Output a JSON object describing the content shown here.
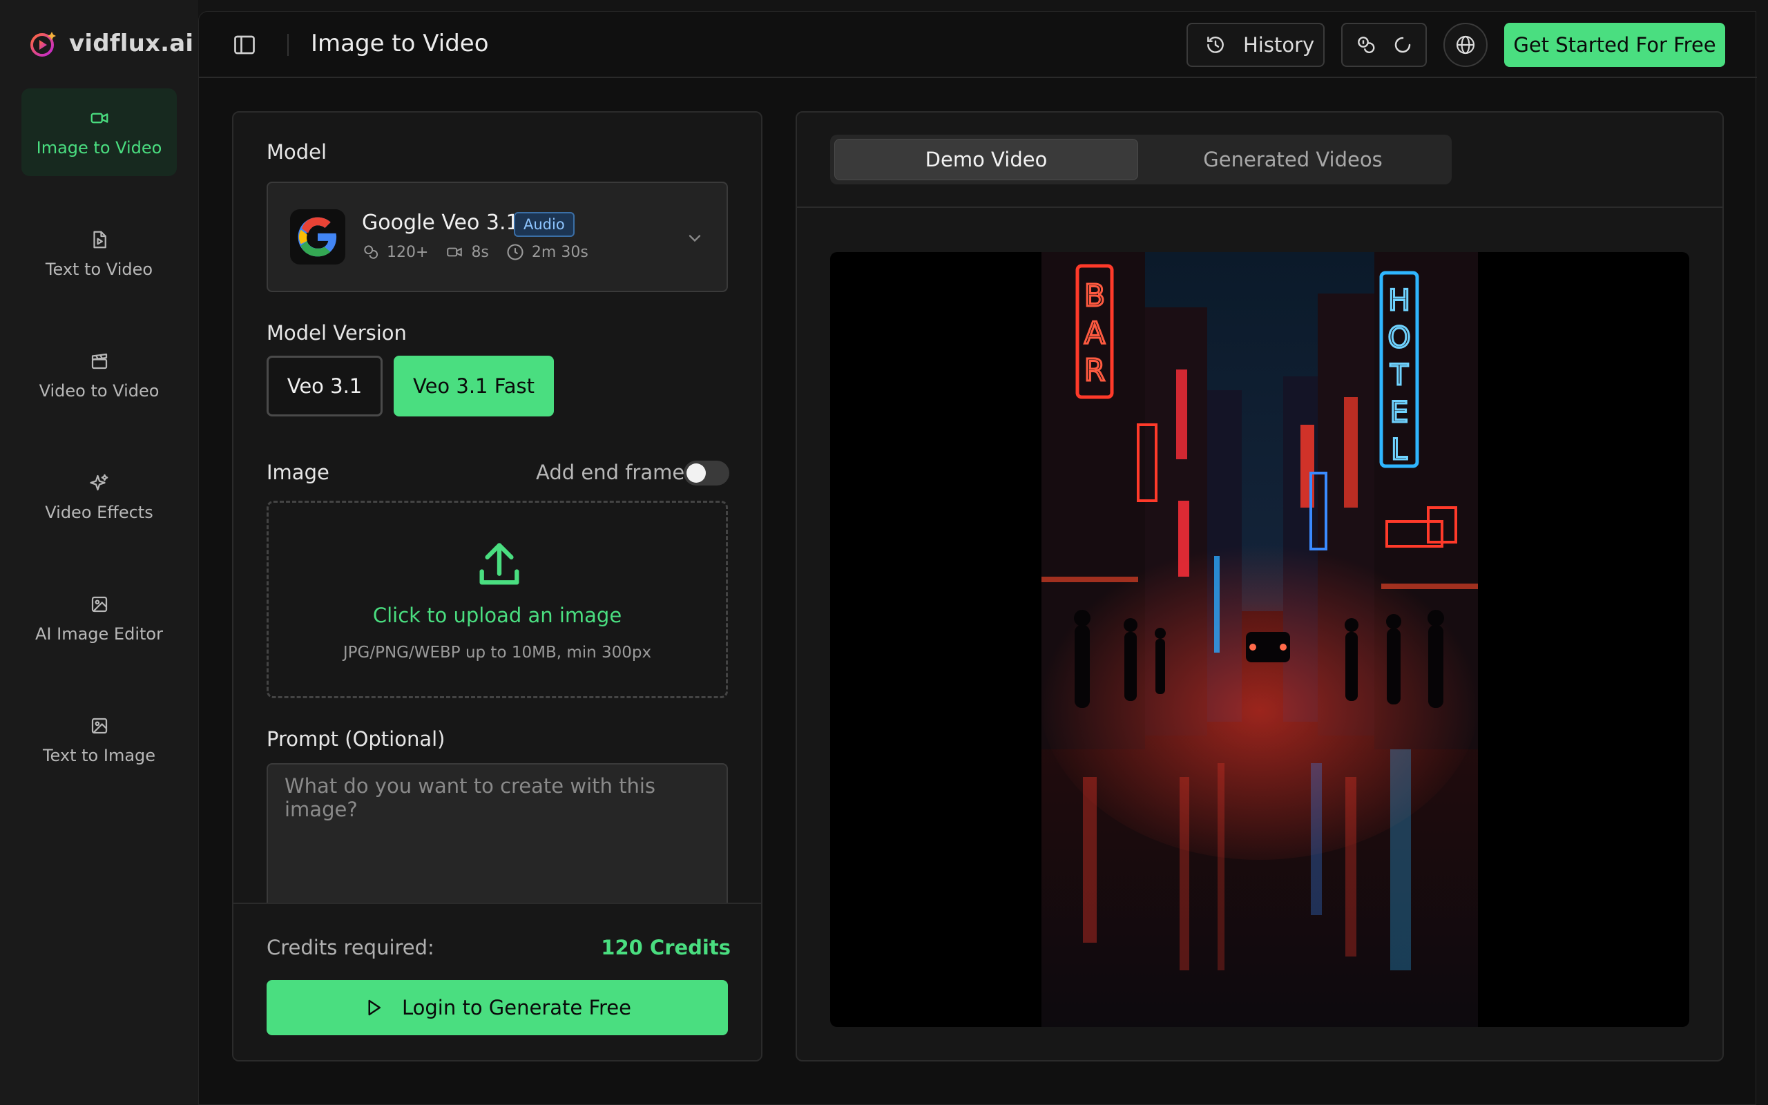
{
  "app": {
    "name": "vidflux.ai"
  },
  "colors": {
    "accent": "#4ade80",
    "background": "#141414",
    "panel": "#171717",
    "badge": "#1c3553"
  },
  "sidebar": {
    "items": [
      {
        "label": "Image to Video",
        "icon": "video-camera-icon",
        "active": true
      },
      {
        "label": "Text to Video",
        "icon": "document-play-icon",
        "active": false
      },
      {
        "label": "Video to Video",
        "icon": "clapperboard-icon",
        "active": false
      },
      {
        "label": "Video Effects",
        "icon": "sparkles-icon",
        "active": false
      },
      {
        "label": "AI Image Editor",
        "icon": "image-icon",
        "active": false
      },
      {
        "label": "Text to Image",
        "icon": "image-icon",
        "active": false
      }
    ]
  },
  "header": {
    "title": "Image to Video",
    "history_label": "History",
    "cta_label": "Get Started For Free"
  },
  "form": {
    "model_label": "Model",
    "model": {
      "name": "Google Veo 3.1",
      "badge": "Audio",
      "credits": "120+",
      "duration": "8s",
      "time": "2m 30s"
    },
    "version_label": "Model Version",
    "versions": [
      {
        "label": "Veo 3.1",
        "selected": false
      },
      {
        "label": "Veo 3.1 Fast",
        "selected": true
      }
    ],
    "image_label": "Image",
    "end_frame_label": "Add end frame",
    "end_frame_enabled": false,
    "upload_title": "Click to upload an image",
    "upload_hint": "JPG/PNG/WEBP up to 10MB, min 300px",
    "prompt_label": "Prompt (Optional)",
    "prompt_placeholder": "What do you want to create with this image?",
    "prompt_value": ""
  },
  "footer": {
    "credits_label": "Credits required:",
    "credits_value": "120 Credits",
    "login_label": "Login to Generate Free"
  },
  "preview": {
    "tabs": [
      {
        "label": "Demo Video",
        "active": true
      },
      {
        "label": "Generated Videos",
        "active": false
      }
    ],
    "signs": {
      "left": "BAR",
      "right": "HOTEL"
    }
  }
}
